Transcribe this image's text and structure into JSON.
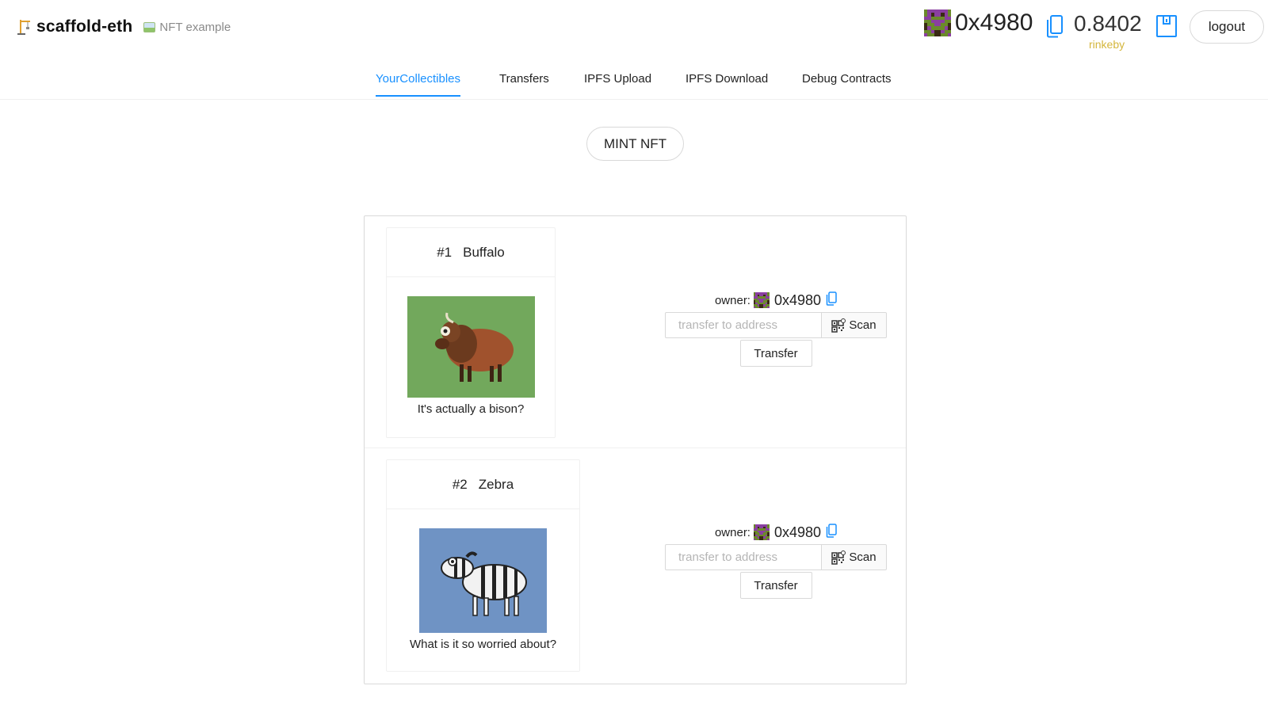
{
  "header": {
    "title": "scaffold-eth",
    "subtitle": "NFT example"
  },
  "account": {
    "address": "0x4980",
    "balance": "0.8402",
    "network": "rinkeby",
    "logout_label": "logout"
  },
  "tabs": [
    {
      "label": "YourCollectibles",
      "active": true
    },
    {
      "label": "Transfers",
      "active": false
    },
    {
      "label": "IPFS Upload",
      "active": false
    },
    {
      "label": "IPFS Download",
      "active": false
    },
    {
      "label": "Debug Contracts",
      "active": false
    }
  ],
  "mint_label": "MINT NFT",
  "collectibles": [
    {
      "id": "#1",
      "name": "Buffalo",
      "description": "It's actually a bison?",
      "owner_label": "owner:",
      "owner_address": "0x4980",
      "transfer_placeholder": "transfer to address",
      "scan_label": "Scan",
      "transfer_label": "Transfer"
    },
    {
      "id": "#2",
      "name": "Zebra",
      "description": "What is it so worried about?",
      "owner_label": "owner:",
      "owner_address": "0x4980",
      "transfer_placeholder": "transfer to address",
      "scan_label": "Scan",
      "transfer_label": "Transfer"
    }
  ],
  "colors": {
    "accent": "#1890ff",
    "network": "#d4b63c",
    "border": "#d9d9d9"
  }
}
